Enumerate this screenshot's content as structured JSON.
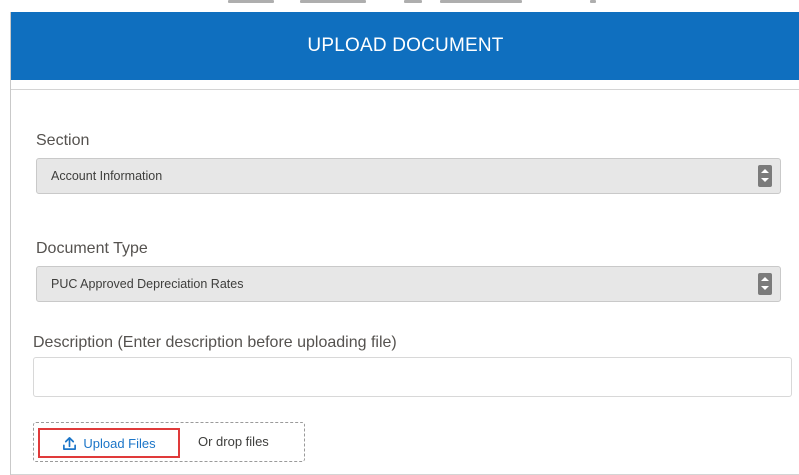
{
  "modal": {
    "title": "UPLOAD DOCUMENT"
  },
  "form": {
    "section": {
      "label": "Section",
      "value": "Account Information"
    },
    "document_type": {
      "label": "Document Type",
      "value": "PUC Approved Depreciation Rates"
    },
    "description": {
      "label": "Description (Enter description before uploading file)",
      "value": ""
    },
    "upload": {
      "button_label": "Upload Files",
      "drop_label": "Or drop files",
      "icon": "upload-icon"
    }
  },
  "colors": {
    "header": "#0f6fbf",
    "link": "#1b75c8",
    "highlight": "#e03a3a"
  }
}
